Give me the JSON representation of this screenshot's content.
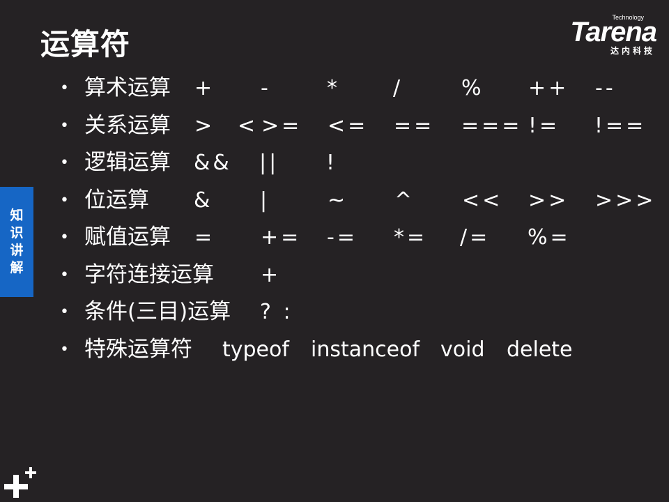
{
  "title": "运算符",
  "logo": {
    "tech": "Technology",
    "word": "Tarena",
    "sub": "达内科技"
  },
  "side_tab": [
    "知",
    "识",
    "讲",
    "解"
  ],
  "rows": [
    {
      "label": "算术运算",
      "ops": [
        "+",
        "-",
        "*",
        "/",
        "%",
        "++",
        "--"
      ]
    },
    {
      "label": "关系运算",
      "ops": [
        ">",
        "<",
        ">=",
        "<=",
        "==",
        "===",
        "!=",
        "!=="
      ]
    },
    {
      "label": "逻辑运算",
      "ops": [
        "&&",
        "||",
        "!"
      ]
    },
    {
      "label": "位运算",
      "ops": [
        "&",
        "|",
        "~",
        "^",
        "<<",
        ">>",
        ">>>"
      ]
    },
    {
      "label": "赋值运算",
      "ops": [
        "=",
        "+=",
        "-=",
        "*=",
        "/=",
        "%="
      ]
    },
    {
      "label": "字符连接运算",
      "ops": [
        "+"
      ]
    },
    {
      "label": "条件(三目)运算",
      "ops": [
        "? :"
      ]
    },
    {
      "label": "特殊运算符",
      "ops": [
        "typeof",
        "instanceof",
        "void",
        "delete"
      ]
    }
  ],
  "colors": {
    "background": "#252224",
    "side_tab": "#1666c5",
    "text": "#ffffff"
  }
}
